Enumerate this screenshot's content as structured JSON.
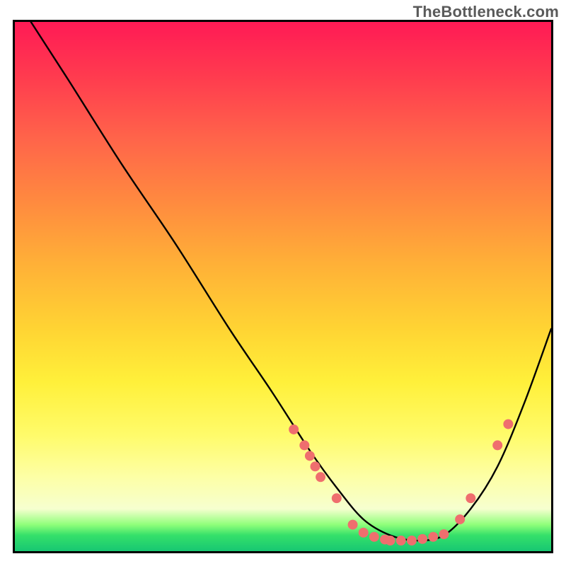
{
  "watermark": "TheBottleneck.com",
  "chart_data": {
    "type": "line",
    "title": "",
    "xlabel": "",
    "ylabel": "",
    "xlim": [
      0,
      100
    ],
    "ylim": [
      0,
      100
    ],
    "curve": {
      "x": [
        3,
        10,
        20,
        30,
        40,
        48,
        55,
        60,
        65,
        70,
        75,
        80,
        85,
        90,
        95,
        100
      ],
      "y": [
        100,
        89,
        73,
        58,
        42,
        30,
        19,
        12,
        6,
        3,
        2,
        3,
        8,
        16,
        28,
        42
      ]
    },
    "markers": [
      {
        "x": 52,
        "y": 23
      },
      {
        "x": 54,
        "y": 20
      },
      {
        "x": 55,
        "y": 18
      },
      {
        "x": 56,
        "y": 16
      },
      {
        "x": 57,
        "y": 14
      },
      {
        "x": 60,
        "y": 10
      },
      {
        "x": 63,
        "y": 5
      },
      {
        "x": 65,
        "y": 3.5
      },
      {
        "x": 67,
        "y": 2.7
      },
      {
        "x": 69,
        "y": 2.2
      },
      {
        "x": 70,
        "y": 2
      },
      {
        "x": 72,
        "y": 2
      },
      {
        "x": 74,
        "y": 2
      },
      {
        "x": 76,
        "y": 2.3
      },
      {
        "x": 78,
        "y": 2.7
      },
      {
        "x": 80,
        "y": 3.2
      },
      {
        "x": 83,
        "y": 6
      },
      {
        "x": 85,
        "y": 10
      },
      {
        "x": 90,
        "y": 20
      },
      {
        "x": 92,
        "y": 24
      }
    ],
    "gradient_stops": [
      {
        "pos": 0,
        "color": "#ff1a55"
      },
      {
        "pos": 50,
        "color": "#ffcf33"
      },
      {
        "pos": 85,
        "color": "#fbffb0"
      },
      {
        "pos": 100,
        "color": "#17c772"
      }
    ]
  }
}
